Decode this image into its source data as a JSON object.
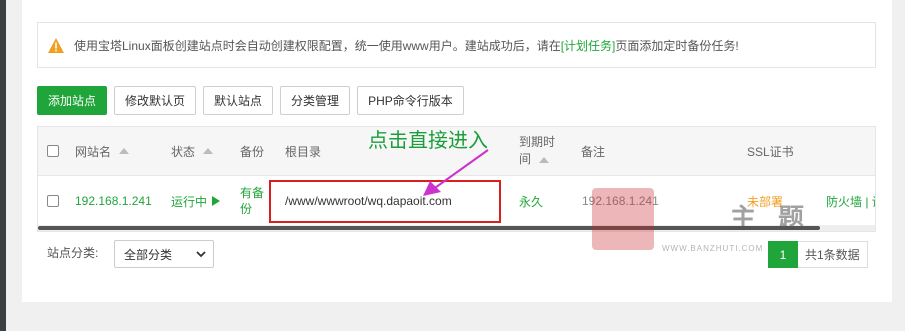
{
  "notice": {
    "text_before": "使用宝塔Linux面板创建站点时会自动创建权限配置，统一使用www用户。建站成功后，请在",
    "link": "[计划任务]",
    "text_after": "页面添加定时备份任务!"
  },
  "toolbar": {
    "add_site": "添加站点",
    "edit_default_page": "修改默认页",
    "default_site": "默认站点",
    "category_manage": "分类管理",
    "php_cli_version": "PHP命令行版本"
  },
  "table": {
    "headers": {
      "site_name": "网站名",
      "status": "状态",
      "backup": "备份",
      "root_dir": "根目录",
      "expire_line1": "到期时",
      "expire_line2": "间",
      "remark": "备注",
      "ssl": "SSL证书"
    },
    "rows": [
      {
        "site_name": "192.168.1.241",
        "status": "运行中",
        "backup_line1": "有备",
        "backup_line2": "份",
        "root_dir": "/www/wwwroot/wq.dapaoit.com",
        "expire": "永久",
        "remark": "192.168.1.241",
        "ssl": "未部署",
        "firewall": "防火墙 | 设"
      }
    ]
  },
  "annotation": {
    "text": "点击直接进入",
    "color": "#1a9d3a"
  },
  "footer": {
    "category_label": "站点分类:",
    "category_selected": "全部分类",
    "current_page": "1",
    "total_text": "共1条数据"
  },
  "watermark": {
    "chars": [
      "主",
      "题"
    ],
    "url": "WWW.BANZHUTI.COM"
  },
  "colors": {
    "accent": "#20a53a",
    "warning": "#f0a020",
    "annotation_box": "#d9201f",
    "arrow": "#cc33cc"
  }
}
